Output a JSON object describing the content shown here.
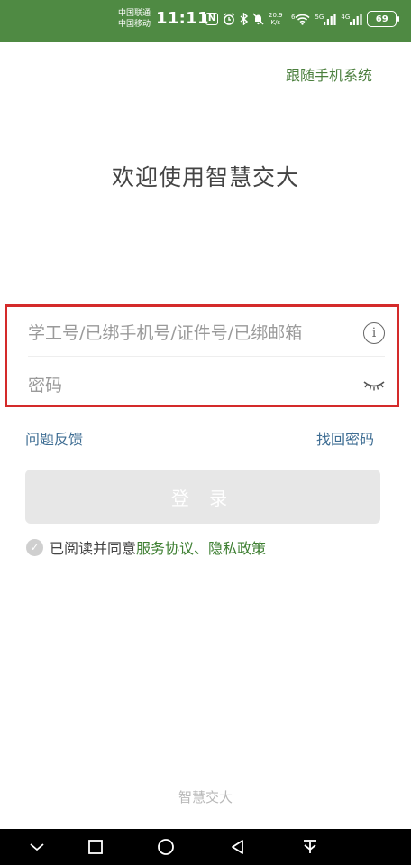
{
  "status_bar": {
    "carrier_1": "中国联通",
    "carrier_2": "中国移动",
    "time": "11:11",
    "nfc": "N",
    "network_speed_value": "20.9",
    "network_speed_unit": "K/s",
    "wifi_badge": "6",
    "signal_1_label": "5G",
    "signal_2_label": "4G",
    "battery": "69",
    "background_color": "#4f8a43"
  },
  "header": {
    "follow_system_label": "跟随手机系统"
  },
  "main": {
    "welcome_title": "欢迎使用智慧交大",
    "account_input": {
      "value": "",
      "placeholder": "学工号/已绑手机号/证件号/已绑邮箱"
    },
    "password_input": {
      "value": "",
      "placeholder": "密码"
    },
    "feedback_label": "问题反馈",
    "find_password_label": "找回密码",
    "login_label": "登 录",
    "agreement": {
      "prefix": "已阅读并同意",
      "links": "服务协议、隐私政策"
    },
    "highlight_color": "#d42a2a",
    "link_color": "#3e6d93",
    "accent_green": "#3e7f32"
  },
  "footer": {
    "brand": "智慧交大"
  },
  "icons": {
    "info": "info-icon",
    "eye": "eye-closed-icon",
    "check": "check-circle-icon",
    "nav_back": "back-triangle-icon",
    "nav_home": "home-circle-icon",
    "nav_recent": "recent-square-icon"
  }
}
